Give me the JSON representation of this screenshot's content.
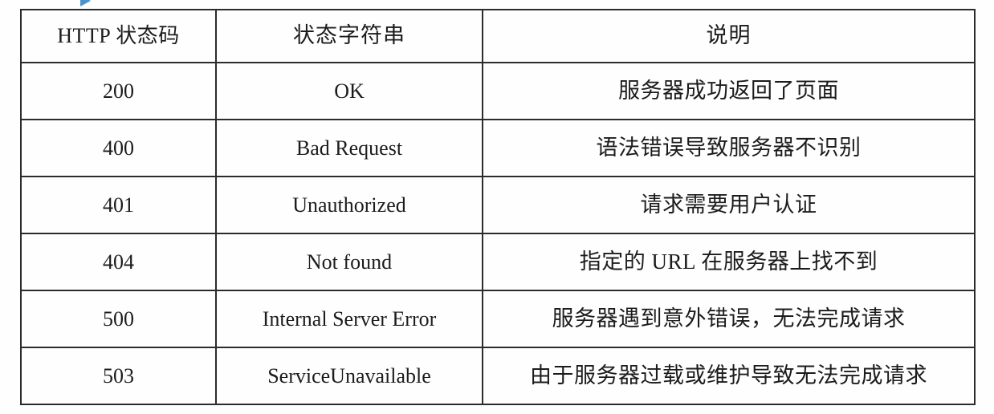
{
  "top_strip": {
    "logo_icon": "blue-triangle-logo-icon",
    "left_fragment": "———— ——————",
    "right_fragment": "——  ———  —————"
  },
  "table": {
    "headers": {
      "code": "HTTP 状态码",
      "string": "状态字符串",
      "description": "说明"
    },
    "rows": [
      {
        "code": "200",
        "string": "OK",
        "description": "服务器成功返回了页面"
      },
      {
        "code": "400",
        "string": "Bad Request",
        "description": "语法错误导致服务器不识别"
      },
      {
        "code": "401",
        "string": "Unauthorized",
        "description": "请求需要用户认证"
      },
      {
        "code": "404",
        "string": "Not found",
        "description": "指定的 URL 在服务器上找不到"
      },
      {
        "code": "500",
        "string": "Internal Server Error",
        "description": "服务器遇到意外错误，无法完成请求"
      },
      {
        "code": "503",
        "string": "ServiceUnavailable",
        "description": "由于服务器过载或维护导致无法完成请求"
      }
    ]
  },
  "colors": {
    "border": "#2b2b2b",
    "text": "#1c1c1c",
    "page_background": "#fefefe",
    "logo_blue": "#2f7fc4"
  }
}
